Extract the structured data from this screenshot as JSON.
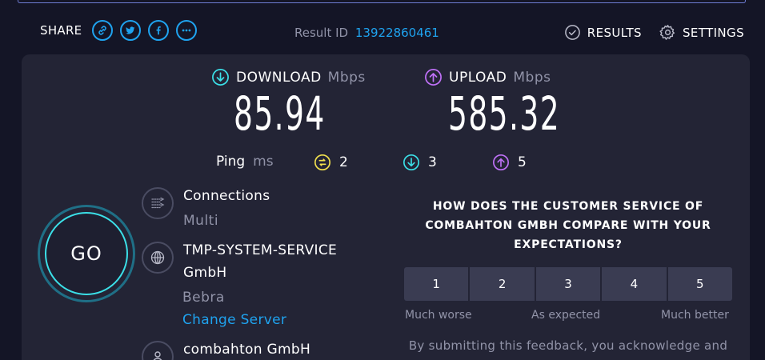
{
  "header": {
    "share_label": "SHARE",
    "share_buttons": [
      "link-icon",
      "twitter-icon",
      "facebook-icon",
      "more-icon"
    ],
    "result_id_label": "Result ID",
    "result_id_value": "13922860461",
    "results_label": "RESULTS",
    "settings_label": "SETTINGS"
  },
  "download": {
    "label": "DOWNLOAD",
    "unit": "Mbps",
    "value": "85.94"
  },
  "upload": {
    "label": "UPLOAD",
    "unit": "Mbps",
    "value": "585.32"
  },
  "ping": {
    "label": "Ping",
    "unit": "ms",
    "idle": "2",
    "download": "3",
    "upload": "5"
  },
  "go_label": "GO",
  "connections": {
    "title": "Connections",
    "value": "Multi"
  },
  "server": {
    "name_line1": "TMP-SYSTEM-SERVICE",
    "name_line2": "GmbH",
    "location": "Bebra",
    "change_label": "Change Server"
  },
  "isp": {
    "name": "combahton GmbH"
  },
  "survey": {
    "question": "HOW DOES THE CUSTOMER SERVICE OF COMBAHTON GMBH COMPARE WITH YOUR EXPECTATIONS?",
    "options": [
      "1",
      "2",
      "3",
      "4",
      "5"
    ],
    "low_label": "Much worse",
    "mid_label": "As expected",
    "high_label": "Much better",
    "disclaimer": "By submitting this feedback, you acknowledge and"
  },
  "colors": {
    "accent": "#1fa3ef",
    "download": "#3be0e8",
    "upload": "#bf71f7",
    "ping": "#f2e14e",
    "background": "#141526",
    "panel": "#232435"
  }
}
